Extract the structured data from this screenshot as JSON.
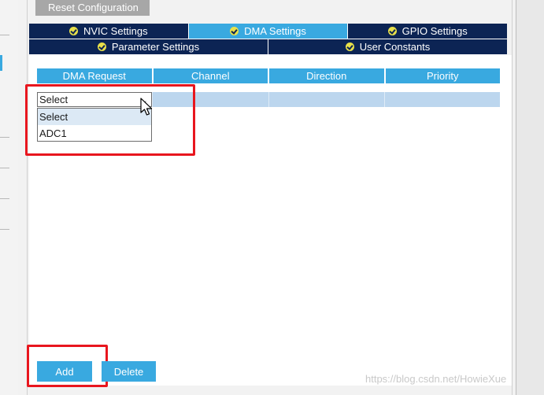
{
  "toolbar": {
    "reset_label": "Reset Configuration"
  },
  "tabs": {
    "row1": [
      {
        "label": "NVIC Settings",
        "icon": "check-circle-icon",
        "active": false
      },
      {
        "label": "DMA Settings",
        "icon": "check-circle-icon",
        "active": true
      },
      {
        "label": "GPIO Settings",
        "icon": "check-circle-icon",
        "active": false
      }
    ],
    "row2": [
      {
        "label": "Parameter Settings",
        "icon": "check-circle-icon",
        "active": false
      },
      {
        "label": "User Constants",
        "icon": "check-circle-icon",
        "active": false
      }
    ]
  },
  "table": {
    "headers": [
      "DMA Request",
      "Channel",
      "Direction",
      "Priority"
    ],
    "rows": [
      [
        "Select",
        "",
        "",
        ""
      ]
    ]
  },
  "dropdown": {
    "selected": "Select",
    "options": [
      "Select",
      "ADC1"
    ]
  },
  "actions": {
    "add_label": "Add",
    "delete_label": "Delete"
  },
  "watermark": "https://blog.csdn.net/HowieXue",
  "colors": {
    "tab_dark": "#0c2454",
    "accent": "#39a9e0",
    "row_fill": "#bcd6ee",
    "annotation_red": "#e8161e",
    "reset_gray": "#a7a7a7"
  }
}
